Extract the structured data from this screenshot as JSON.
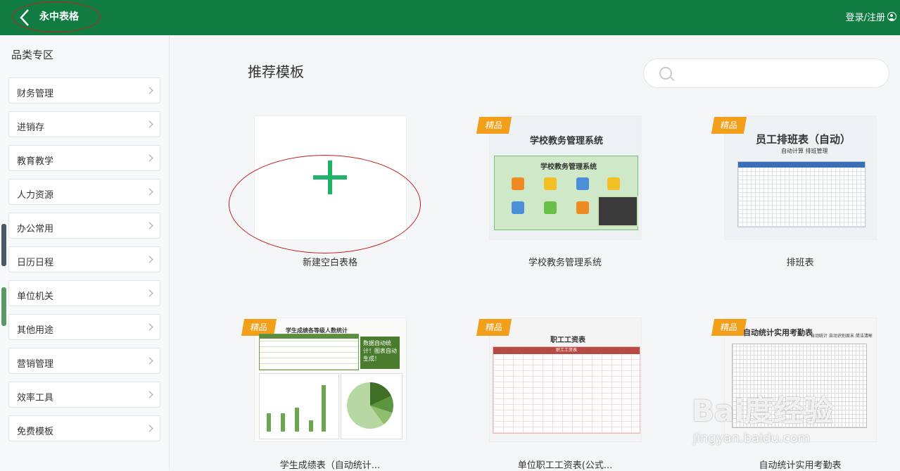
{
  "header": {
    "title": "永中表格",
    "login": "登录/注册"
  },
  "sidebar": {
    "title": "品类专区",
    "items": [
      {
        "label": "财务管理"
      },
      {
        "label": "进销存"
      },
      {
        "label": "教育教学"
      },
      {
        "label": "人力资源"
      },
      {
        "label": "办公常用"
      },
      {
        "label": "日历日程"
      },
      {
        "label": "单位机关"
      },
      {
        "label": "其他用途"
      },
      {
        "label": "营销管理"
      },
      {
        "label": "效率工具"
      },
      {
        "label": "免费模板"
      }
    ]
  },
  "main": {
    "title": "推荐模板",
    "badge": "精品",
    "cards": [
      {
        "label": "新建空白表格"
      },
      {
        "label": "学校教务管理系统",
        "thumb_title": "学校教务管理系统",
        "thumb_sub": "学校教务管理系统"
      },
      {
        "label": "排班表",
        "thumb_title": "员工排班表（自动）",
        "thumb_sub": "自动计算 排班管理"
      },
      {
        "label": "学生成绩表（自动统计...",
        "thumb_title": "学生成绩各等级人数统计",
        "thumb_sub": "数据自动统计！图表自动生成！"
      },
      {
        "label": "单位职工工资表(公式...",
        "thumb_title": "职工工资表",
        "thumb_sub": "职工工资表"
      },
      {
        "label": "自动统计实用考勤表",
        "thumb_title": "自动统计实用考勤表",
        "thumb_sub": "自动统计 自动识别周末 简洁清晰"
      }
    ]
  },
  "watermark": {
    "line1": "Bai度经验",
    "line2": "jingyan.baidu.com"
  },
  "colors": {
    "brand": "#107c41",
    "badge": "#f2a01c",
    "plus": "#1fb36a",
    "annotation": "#c41f1f"
  }
}
